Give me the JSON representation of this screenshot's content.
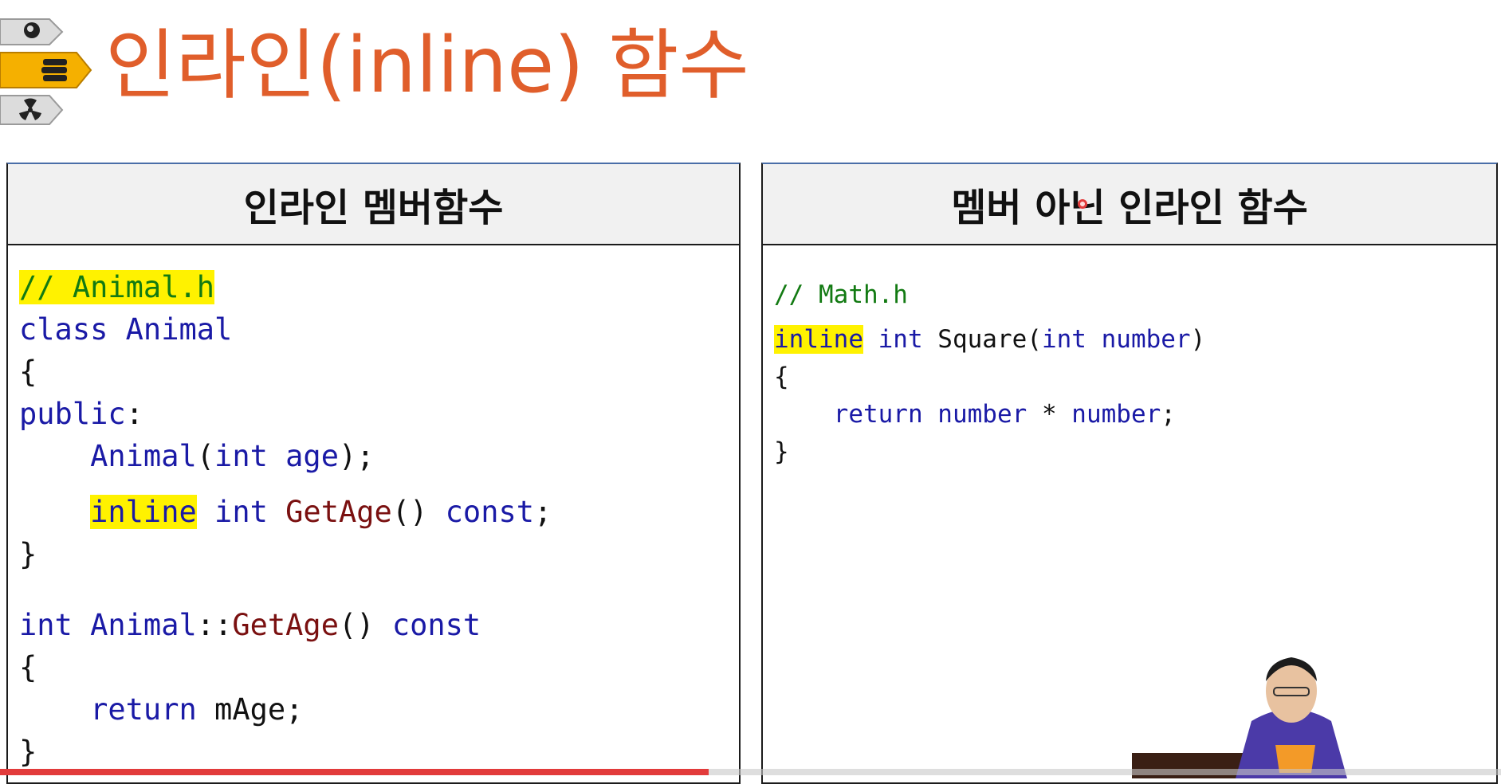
{
  "title": "인라인(inline) 함수",
  "nav_icons": [
    "brain-icon",
    "book-stack-icon",
    "radiation-icon"
  ],
  "left_panel": {
    "header": "인라인 멤버함수",
    "code": [
      [
        {
          "t": "// Animal.h",
          "c": "cm",
          "hl": true
        }
      ],
      [
        {
          "t": "class ",
          "c": "kw"
        },
        {
          "t": "Animal",
          "c": "kw"
        }
      ],
      [
        {
          "t": "{",
          "c": ""
        }
      ],
      [
        {
          "t": "public",
          "c": "kw"
        },
        {
          "t": ":",
          "c": ""
        }
      ],
      [
        {
          "t": "    ",
          "c": ""
        },
        {
          "t": "Animal",
          "c": "kw"
        },
        {
          "t": "(",
          "c": ""
        },
        {
          "t": "int",
          "c": "kw"
        },
        {
          "t": " age",
          "c": "kw"
        },
        {
          "t": ");",
          "c": ""
        }
      ],
      [],
      [
        {
          "t": "    ",
          "c": ""
        },
        {
          "t": "inline",
          "c": "kw",
          "hl": true
        },
        {
          "t": " int",
          "c": "kw"
        },
        {
          "t": " GetAge",
          "c": "fn"
        },
        {
          "t": "() ",
          "c": ""
        },
        {
          "t": "const",
          "c": "kw"
        },
        {
          "t": ";",
          "c": ""
        }
      ],
      [
        {
          "t": "}",
          "c": ""
        }
      ],
      [],
      [
        {
          "t": "int",
          "c": "kw"
        },
        {
          "t": " Animal",
          "c": "kw"
        },
        {
          "t": "::",
          "c": ""
        },
        {
          "t": "GetAge",
          "c": "fn"
        },
        {
          "t": "() ",
          "c": ""
        },
        {
          "t": "const",
          "c": "kw"
        }
      ],
      [
        {
          "t": "{",
          "c": ""
        }
      ],
      [
        {
          "t": "    ",
          "c": ""
        },
        {
          "t": "return",
          "c": "kw"
        },
        {
          "t": " mAge;",
          "c": ""
        }
      ],
      [
        {
          "t": "}",
          "c": ""
        }
      ]
    ]
  },
  "right_panel": {
    "header": "멤버 아닌 인라인 함수",
    "code": [
      [
        {
          "t": "// Math.h",
          "c": "cm"
        }
      ],
      [
        {
          "t": "inline",
          "c": "kw",
          "hl": true
        },
        {
          "t": " int",
          "c": "kw"
        },
        {
          "t": " Square(",
          "c": ""
        },
        {
          "t": "int",
          "c": "kw"
        },
        {
          "t": " number",
          "c": "kw"
        },
        {
          "t": ")",
          "c": ""
        }
      ],
      [
        {
          "t": "{",
          "c": ""
        }
      ],
      [
        {
          "t": "    ",
          "c": ""
        },
        {
          "t": "return",
          "c": "kw"
        },
        {
          "t": " number",
          "c": "kw"
        },
        {
          "t": " * ",
          "c": ""
        },
        {
          "t": "number",
          "c": "kw"
        },
        {
          "t": ";",
          "c": ""
        }
      ],
      [
        {
          "t": "}",
          "c": ""
        }
      ]
    ]
  },
  "video_progress": 0.472,
  "colors": {
    "title": "#e05e2b",
    "keyword": "#1a1aa6",
    "function": "#7a1010",
    "comment": "#127a12",
    "highlight": "#fff200",
    "progress": "#e23b3b"
  }
}
